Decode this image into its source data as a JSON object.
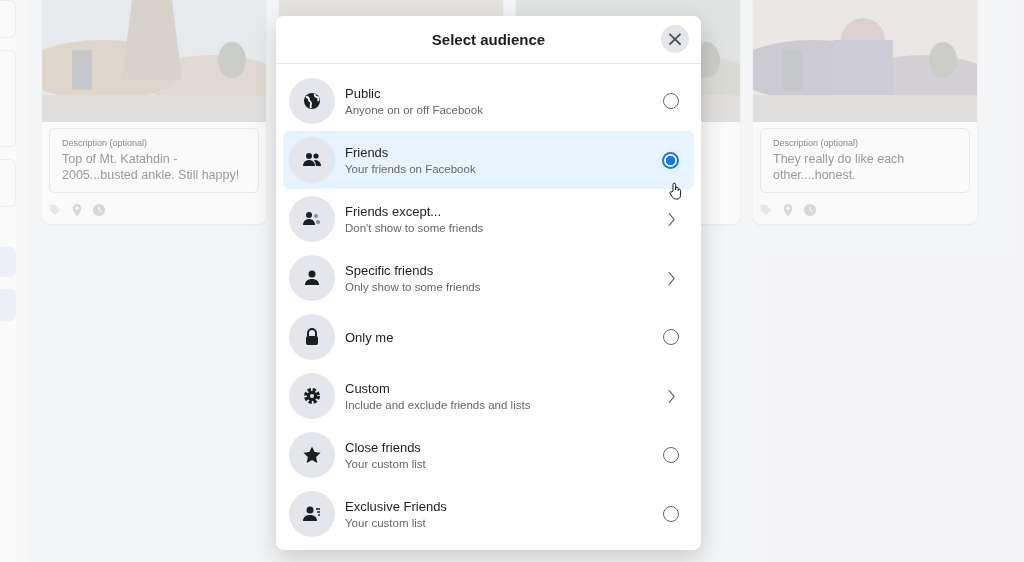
{
  "background_cards": [
    {
      "field_label": "Description (optional)",
      "value": "Top of Mt. Katahdin - 2005...busted ankle.  Still happy!"
    },
    {
      "field_label": "Description (optional)",
      "value": "They really do like each other....honest."
    }
  ],
  "dialog": {
    "title": "Select audience",
    "close": "×",
    "options": [
      {
        "kind": "radio",
        "label": "Public",
        "description": "Anyone on or off Facebook",
        "selected": false
      },
      {
        "kind": "radio",
        "label": "Friends",
        "description": "Your friends on Facebook",
        "selected": true
      },
      {
        "kind": "submenu",
        "label": "Friends except...",
        "description": "Don't show to some friends",
        "selected": false
      },
      {
        "kind": "submenu",
        "label": "Specific friends",
        "description": "Only show to some friends",
        "selected": false
      },
      {
        "kind": "radio",
        "label": "Only me",
        "selected": false
      },
      {
        "kind": "submenu",
        "label": "Custom",
        "description": "Include and exclude friends and lists",
        "selected": false
      },
      {
        "kind": "radio",
        "label": "Close friends",
        "description": "Your custom list",
        "selected": false
      },
      {
        "kind": "radio",
        "label": "Exclusive Friends",
        "description": "Your custom list",
        "selected": false
      }
    ]
  }
}
